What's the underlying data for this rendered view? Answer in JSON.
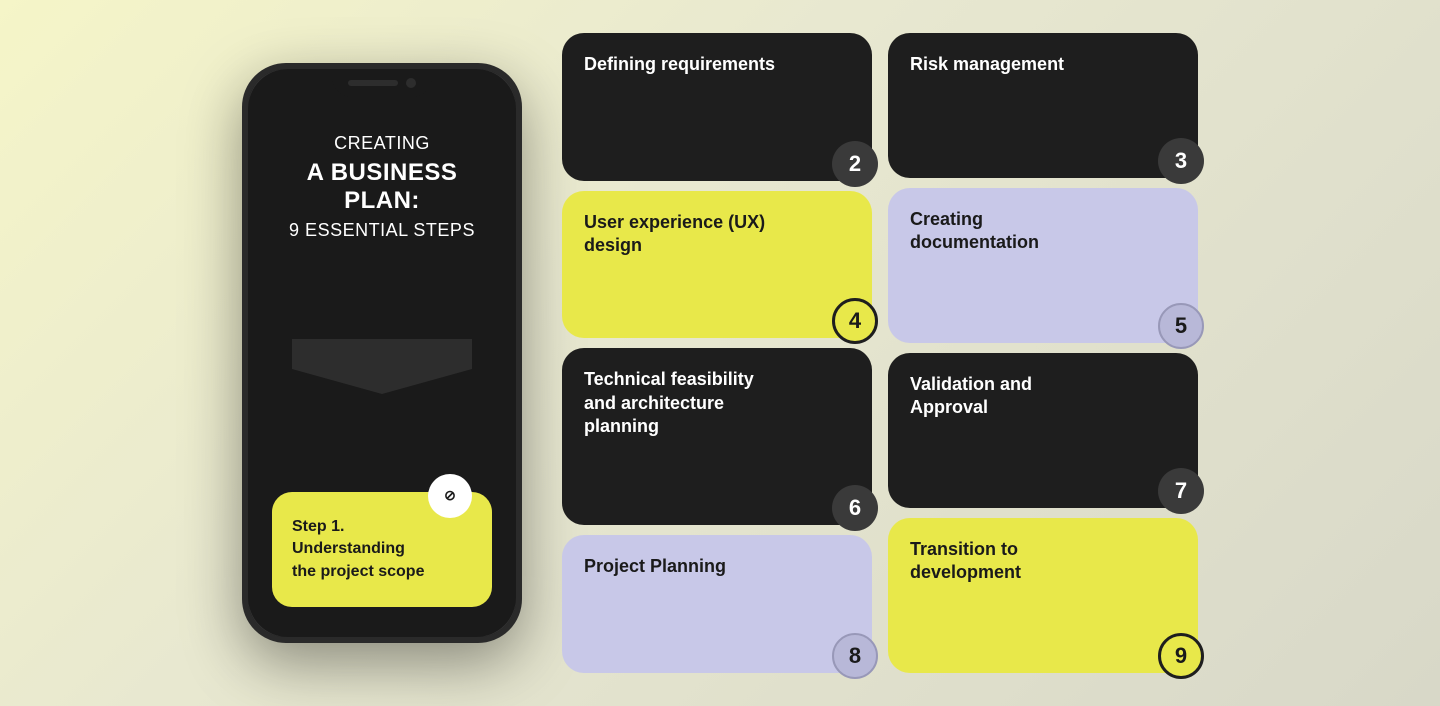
{
  "page": {
    "bg": "#e8e8c8"
  },
  "phone": {
    "title_line1": "CREATING",
    "title_line2": "A BUSINESS PLAN:",
    "title_line3": "9 ESSENTIAL STEPS",
    "card_text_line1": "Step 1.",
    "card_text_line2": "Understanding",
    "card_text_line3": "the project scope",
    "logo_symbol": "≋"
  },
  "column1": {
    "cards": [
      {
        "id": "card-defining",
        "title": "Defining requirements",
        "number": "2",
        "style": "dark"
      },
      {
        "id": "card-ux",
        "title": "User experience (UX) design",
        "number": "4",
        "style": "yellow"
      },
      {
        "id": "card-technical",
        "title": "Technical feasibility and architecture planning",
        "number": "6",
        "style": "dark"
      },
      {
        "id": "card-project",
        "title": "Project Planning",
        "number": "8",
        "style": "lavender"
      }
    ]
  },
  "column2": {
    "cards": [
      {
        "id": "card-risk",
        "title": "Risk management",
        "number": "3",
        "style": "dark"
      },
      {
        "id": "card-docs",
        "title": "Creating documentation",
        "number": "5",
        "style": "lavender"
      },
      {
        "id": "card-validation",
        "title": "Validation and Approval",
        "number": "7",
        "style": "dark"
      },
      {
        "id": "card-transition",
        "title": "Transition to development",
        "number": "9",
        "style": "yellow"
      }
    ]
  }
}
